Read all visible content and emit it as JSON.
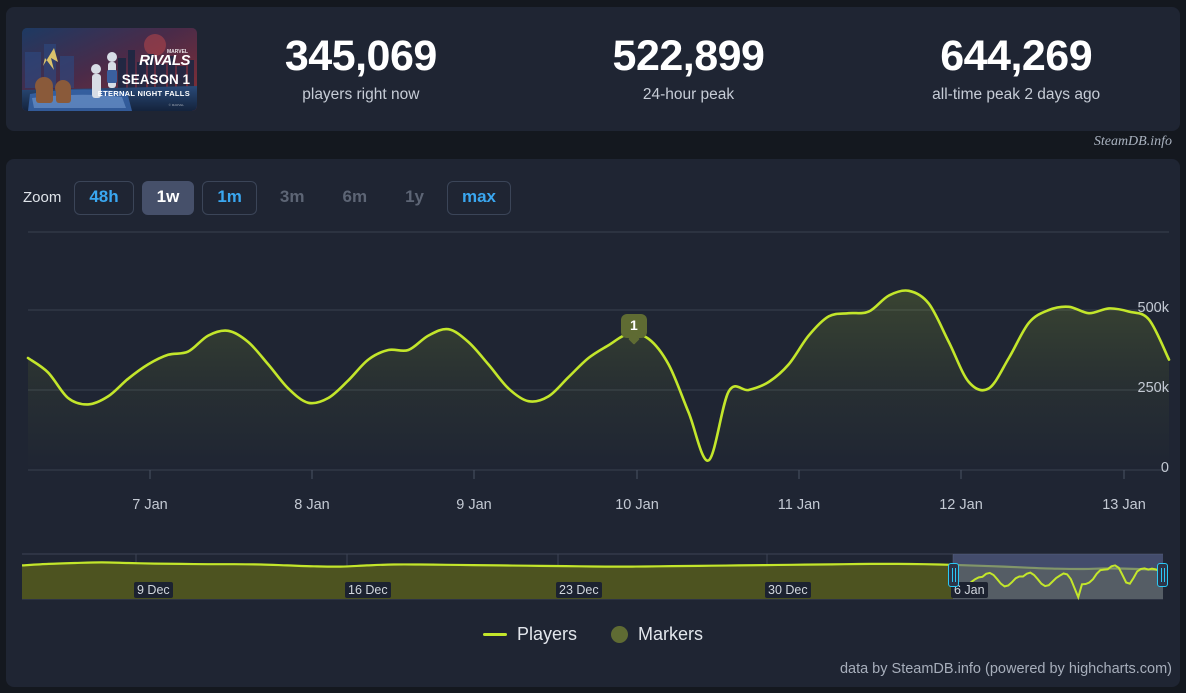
{
  "header": {
    "capsule": {
      "name": "marvel-rivals-season-1-capsule",
      "brand": "RIVALS",
      "season": "SEASON 1",
      "subtitle": "ETERNAL NIGHT FALLS"
    },
    "stats": [
      {
        "value": "345,069",
        "label": "players right now"
      },
      {
        "value": "522,899",
        "label": "24-hour peak"
      },
      {
        "value": "644,269",
        "label": "all-time peak 2 days ago"
      }
    ],
    "credit": "SteamDB.info"
  },
  "zoom": {
    "label": "Zoom",
    "buttons": [
      {
        "label": "48h",
        "state": "outlined"
      },
      {
        "label": "1w",
        "state": "active"
      },
      {
        "label": "1m",
        "state": "outlined"
      },
      {
        "label": "3m",
        "state": "disabled"
      },
      {
        "label": "6m",
        "state": "disabled"
      },
      {
        "label": "1y",
        "state": "disabled"
      },
      {
        "label": "max",
        "state": "outlined"
      }
    ]
  },
  "legend": {
    "players": "Players",
    "markers": "Markers"
  },
  "marker": {
    "label": "1"
  },
  "footer": {
    "credit": "data by SteamDB.info (powered by highcharts.com)"
  },
  "colors": {
    "line": "#c3e62b",
    "accent_blue": "#3aa7f0",
    "handle_cyan": "#2bc8f5",
    "marker_olive": "#5f6b33",
    "panel": "#1f2533",
    "page_bg": "#14181f",
    "navigator_fill": "#4d5320",
    "selection_overlay": "#5a6490"
  },
  "chart_data": {
    "type": "line",
    "title": "",
    "xlabel": "",
    "ylabel": "Players",
    "ylim": [
      0,
      700000
    ],
    "yticks": [
      0,
      250000,
      500000
    ],
    "ytick_labels": [
      "0",
      "250k",
      "500k"
    ],
    "grid": true,
    "legend_position": "bottom",
    "x": [
      "6 Jan 12:00",
      "6 Jan 15:00",
      "6 Jan 18:00",
      "6 Jan 21:00",
      "7 Jan 00:00",
      "7 Jan 03:00",
      "7 Jan 06:00",
      "7 Jan 09:00",
      "7 Jan 12:00",
      "7 Jan 15:00",
      "7 Jan 18:00",
      "7 Jan 21:00",
      "8 Jan 00:00",
      "8 Jan 03:00",
      "8 Jan 06:00",
      "8 Jan 09:00",
      "8 Jan 12:00",
      "8 Jan 15:00",
      "8 Jan 18:00",
      "8 Jan 21:00",
      "9 Jan 00:00",
      "9 Jan 03:00",
      "9 Jan 06:00",
      "9 Jan 09:00",
      "9 Jan 12:00",
      "9 Jan 15:00",
      "9 Jan 18:00",
      "9 Jan 21:00",
      "10 Jan 00:00",
      "10 Jan 03:00",
      "10 Jan 06:00",
      "10 Jan 07:30",
      "10 Jan 09:00",
      "10 Jan 12:00",
      "10 Jan 15:00",
      "10 Jan 18:00",
      "10 Jan 21:00",
      "11 Jan 00:00",
      "11 Jan 03:00",
      "11 Jan 06:00",
      "11 Jan 09:00",
      "11 Jan 12:00",
      "11 Jan 15:00",
      "11 Jan 18:00",
      "11 Jan 21:00",
      "12 Jan 00:00",
      "12 Jan 03:00",
      "12 Jan 06:00",
      "12 Jan 09:00",
      "12 Jan 12:00",
      "12 Jan 15:00",
      "12 Jan 18:00",
      "12 Jan 21:00",
      "13 Jan 00:00",
      "13 Jan 03:00",
      "13 Jan 06:00",
      "13 Jan 09:00",
      "13 Jan 12:00"
    ],
    "series": [
      {
        "name": "Players",
        "color": "#c3e62b",
        "values": [
          350000,
          305000,
          225000,
          205000,
          230000,
          285000,
          330000,
          360000,
          370000,
          420000,
          435000,
          400000,
          330000,
          255000,
          210000,
          225000,
          280000,
          345000,
          375000,
          375000,
          420000,
          440000,
          400000,
          330000,
          255000,
          215000,
          230000,
          290000,
          350000,
          390000,
          425000,
          410000,
          330000,
          180000,
          30000,
          245000,
          250000,
          275000,
          330000,
          420000,
          480000,
          490000,
          495000,
          545000,
          560000,
          520000,
          400000,
          275000,
          255000,
          350000,
          460000,
          500000,
          510000,
          490000,
          505000,
          495000,
          470000,
          345000
        ]
      }
    ],
    "markers": [
      {
        "label": "1",
        "x": "10 Jan 00:00",
        "y": 470000,
        "color": "#5f6b33"
      }
    ],
    "xtick_labels": [
      "7 Jan",
      "8 Jan",
      "9 Jan",
      "10 Jan",
      "11 Jan",
      "12 Jan",
      "13 Jan"
    ],
    "navigator": {
      "xtick_labels": [
        "9 Dec",
        "16 Dec",
        "23 Dec",
        "30 Dec",
        "6 Jan"
      ],
      "selected_range": [
        "6 Jan",
        "13 Jan"
      ],
      "values": [
        560000,
        585000,
        600000,
        610000,
        600000,
        590000,
        585000,
        580000,
        580000,
        575000,
        560000,
        545000,
        540000,
        560000,
        575000,
        575000,
        570000,
        565000,
        560000,
        555000,
        550000,
        545000,
        540000,
        540000,
        545000,
        550000,
        555000,
        560000,
        565000,
        570000,
        575000,
        580000,
        585000,
        585000,
        580000,
        570000,
        555000,
        540000,
        520000,
        505000,
        500000,
        510000,
        500000,
        480000
      ]
    }
  }
}
